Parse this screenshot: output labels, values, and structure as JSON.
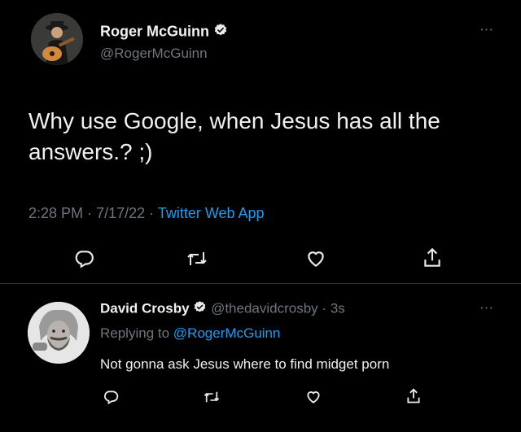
{
  "main_tweet": {
    "author_name": "Roger McGuinn",
    "handle": "@RogerMcGuinn",
    "text_line1": "Why use Google, when Jesus has all the",
    "text_line2": "answers.? ;)",
    "time": "2:28 PM",
    "sep1": "·",
    "date": "7/17/22",
    "sep2": "·",
    "source": "Twitter Web App",
    "more": "···"
  },
  "reply_tweet": {
    "author_name": "David Crosby",
    "handle": "@thedavidcrosby",
    "sep": "·",
    "age": "3s",
    "replying_prefix": "Replying to",
    "replying_handle": "@RogerMcGuinn",
    "text": "Not gonna ask Jesus where to find midget porn",
    "more": "···"
  },
  "icons": [
    "verified-badge-icon",
    "reply-icon",
    "retweet-icon",
    "like-icon",
    "share-icon",
    "more-icon"
  ],
  "colors": {
    "background": "#000000",
    "text": "#e7e9ea",
    "muted": "#6e767d",
    "link": "#1d9bf0"
  }
}
